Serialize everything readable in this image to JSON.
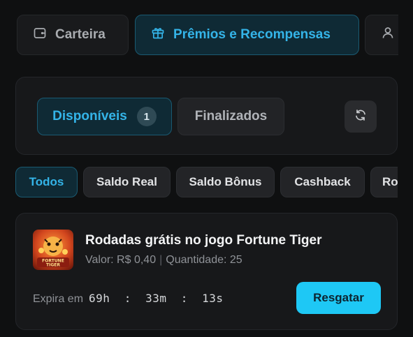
{
  "top_tabs": {
    "wallet": {
      "label": "Carteira",
      "icon": "wallet-icon"
    },
    "rewards": {
      "label": "Prêmios e Recompensas",
      "icon": "gift-icon"
    },
    "profile": {
      "icon": "user-icon"
    }
  },
  "status": {
    "available": {
      "label": "Disponíveis",
      "count": "1"
    },
    "finished": {
      "label": "Finalizados"
    },
    "refresh_icon": "refresh-icon"
  },
  "filters": [
    "Todos",
    "Saldo Real",
    "Saldo Bônus",
    "Cashback",
    "Ro"
  ],
  "reward": {
    "title": "Rodadas grátis no jogo Fortune Tiger",
    "value": "Valor: R$ 0,40",
    "separator": "|",
    "quantity": "Quantidade: 25",
    "expires_label": "Expira em",
    "timer": "69h  :  33m  :  13s",
    "claim_label": "Resgatar",
    "thumbnail_text": "FORTUNE TIGER"
  },
  "colors": {
    "accent": "#34b4e8",
    "button": "#1ec8f5",
    "background": "#0f1011",
    "panel": "#17181a"
  }
}
